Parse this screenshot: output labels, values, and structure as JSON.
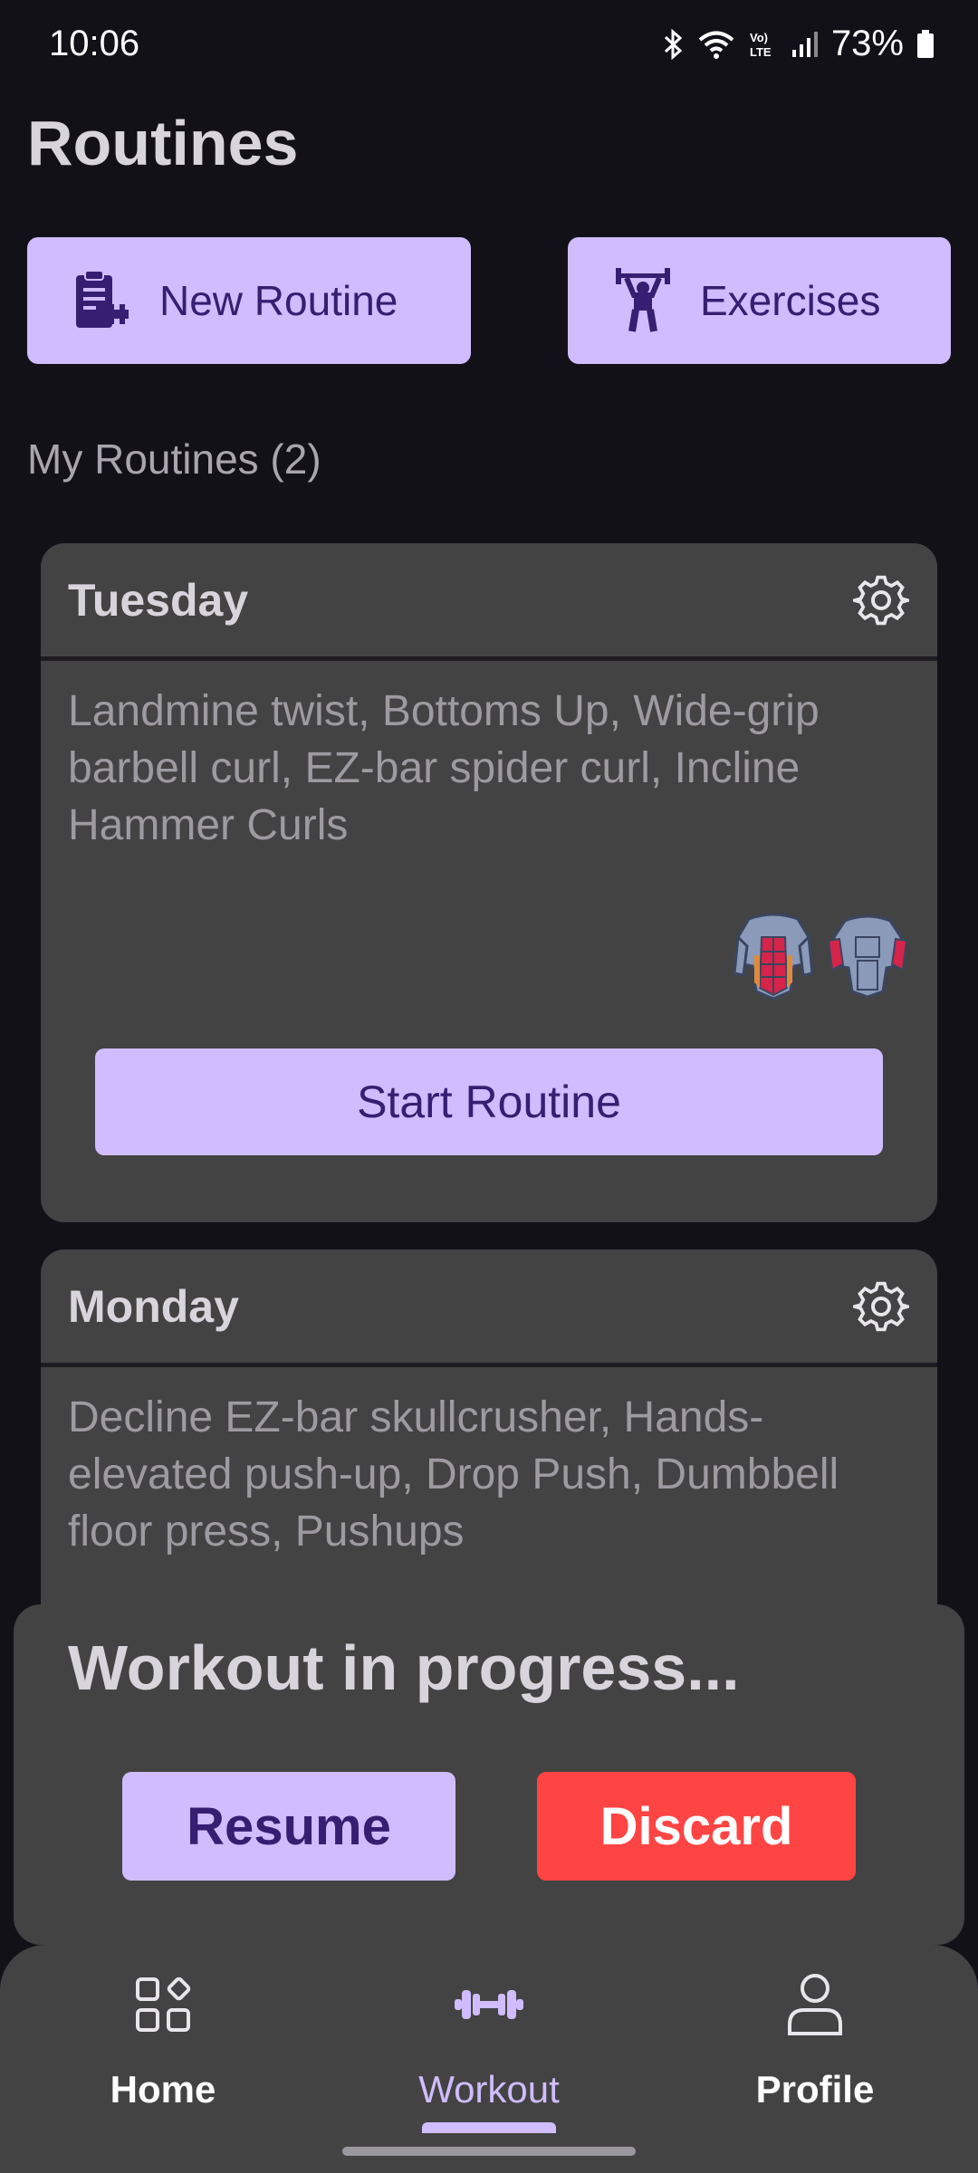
{
  "status": {
    "time": "10:06",
    "battery": "73%",
    "icons": [
      "bluetooth-icon",
      "wifi-icon",
      "volte-icon",
      "signal-icon",
      "battery-icon"
    ]
  },
  "page": {
    "title": "Routines"
  },
  "actions": {
    "new_routine": "New Routine",
    "exercises": "Exercises"
  },
  "routines_section": {
    "label": "My Routines (2)"
  },
  "routines": [
    {
      "name": "Tuesday",
      "exercises": "Landmine twist, Bottoms Up, Wide-grip barbell curl, EZ-bar spider curl, Incline Hammer Curls",
      "muscle_icons": [
        "abs-muscle-icon",
        "biceps-muscle-icon"
      ],
      "start_label": "Start Routine"
    },
    {
      "name": "Monday",
      "exercises": "Decline EZ-bar skullcrusher, Hands-elevated push-up, Drop Push, Dumbbell floor press, Pushups"
    }
  ],
  "workout_progress": {
    "title": "Workout in progress...",
    "resume": "Resume",
    "discard": "Discard"
  },
  "nav": {
    "items": [
      {
        "label": "Home",
        "icon": "home-grid-icon"
      },
      {
        "label": "Workout",
        "icon": "dumbbell-icon"
      },
      {
        "label": "Profile",
        "icon": "person-icon"
      }
    ],
    "active": "Workout"
  },
  "colors": {
    "background": "#131118",
    "surface": "#434343",
    "primary": "#d0bcff",
    "on_primary": "#381e72",
    "danger": "#ff4444"
  }
}
